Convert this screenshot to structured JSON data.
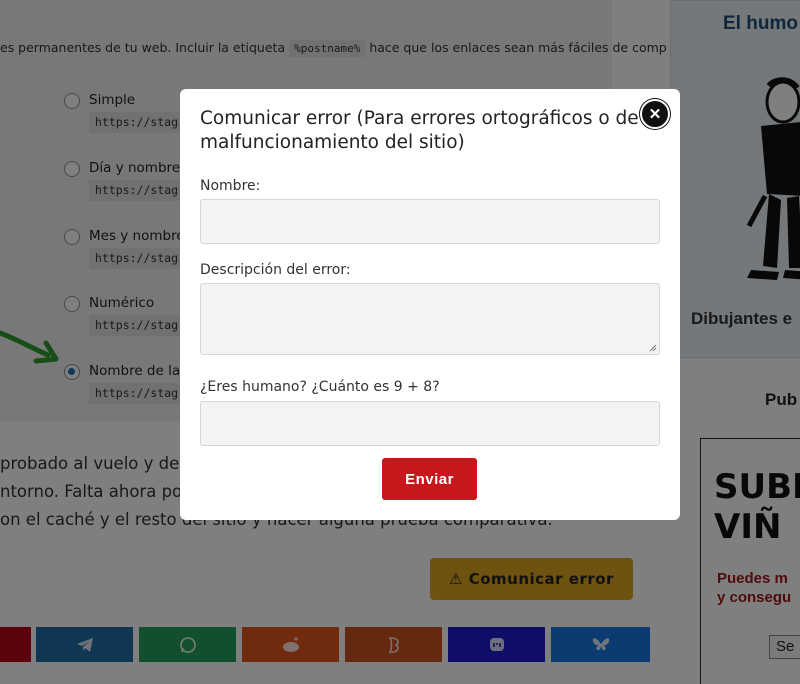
{
  "page": {
    "description_prefix": "es permanentes de tu web. Incluir la etiqueta",
    "description_code": "%postname%",
    "description_suffix": "hace que los enlaces sean más fáciles de comp",
    "options": [
      {
        "label": "Simple",
        "url": "https://stag",
        "checked": false
      },
      {
        "label": "Día y nombre",
        "url": "https://stag",
        "checked": false
      },
      {
        "label": "Mes y nombre",
        "url": "https://stag",
        "checked": false
      },
      {
        "label": "Numérico",
        "url": "https://stag",
        "checked": false
      },
      {
        "label": "Nombre de la",
        "url": "https://stag",
        "checked": true
      }
    ],
    "body_lines": [
      "probado al vuelo y de",
      "ntorno. Falta ahora po",
      "on el caché y el resto del sitio y hacer alguna prueba comparativa."
    ],
    "report_button": "⚠ Comunicar error",
    "share_buttons": [
      {
        "name": "share-pinterest",
        "icon": "pinterest-icon",
        "color": "#b7081b"
      },
      {
        "name": "share-telegram",
        "icon": "telegram-icon",
        "color": "#1f6fa8"
      },
      {
        "name": "share-whatsapp",
        "icon": "whatsapp-icon",
        "color": "#25a05a"
      },
      {
        "name": "share-reddit",
        "icon": "reddit-icon",
        "color": "#e0541c"
      },
      {
        "name": "share-meneame",
        "icon": "meneame-icon",
        "color": "#c8531e"
      },
      {
        "name": "share-mastodon",
        "icon": "mastodon-icon",
        "color": "#1c1ccc"
      },
      {
        "name": "share-bluesky",
        "icon": "bluesky-icon",
        "color": "#1776e0"
      }
    ]
  },
  "sidebar": {
    "title": "El humo",
    "caption": "Dibujantes e",
    "pub_label": "Pub",
    "ad_big_line1": "SUBE",
    "ad_big_line2": "VIÑ",
    "ad_red_line1": "Puedes m",
    "ad_red_line2": "y consegu",
    "ad_select": "Se"
  },
  "modal": {
    "title": "Comunicar error (Para errores ortográficos o de malfuncionamiento del sitio)",
    "close_symbol": "✕",
    "name_label": "Nombre:",
    "name_value": "",
    "description_label": "Descripción del error:",
    "description_value": "",
    "captcha_label": "¿Eres humano? ¿Cuánto es 9 + 8?",
    "captcha_value": "",
    "submit_label": "Enviar"
  },
  "colors": {
    "accent_red": "#c8161d",
    "report_yellow": "#daa520",
    "radio_blue": "#2271b1",
    "arrow_green": "#2e9b2e"
  }
}
